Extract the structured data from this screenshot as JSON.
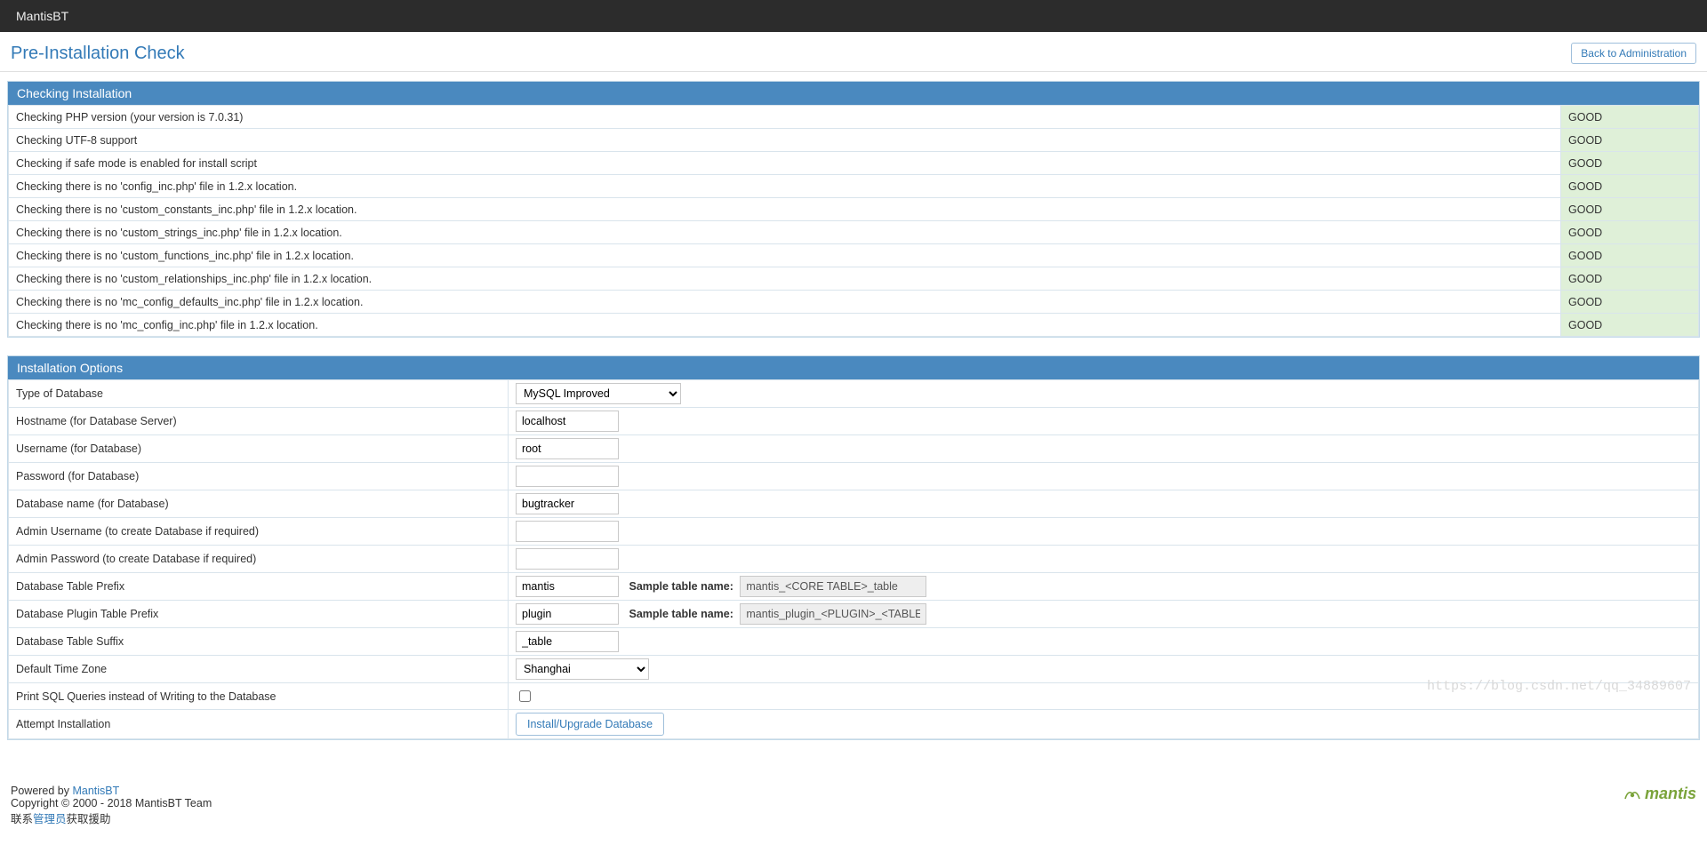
{
  "navbar": {
    "brand": "MantisBT"
  },
  "header": {
    "title": "Pre-Installation Check",
    "back_button": "Back to Administration"
  },
  "checking": {
    "heading": "Checking Installation",
    "rows": [
      {
        "label": "Checking PHP version (your version is 7.0.31)",
        "status": "GOOD"
      },
      {
        "label": "Checking UTF-8 support",
        "status": "GOOD"
      },
      {
        "label": "Checking if safe mode is enabled for install script",
        "status": "GOOD"
      },
      {
        "label": "Checking there is no 'config_inc.php' file in 1.2.x location.",
        "status": "GOOD"
      },
      {
        "label": "Checking there is no 'custom_constants_inc.php' file in 1.2.x location.",
        "status": "GOOD"
      },
      {
        "label": "Checking there is no 'custom_strings_inc.php' file in 1.2.x location.",
        "status": "GOOD"
      },
      {
        "label": "Checking there is no 'custom_functions_inc.php' file in 1.2.x location.",
        "status": "GOOD"
      },
      {
        "label": "Checking there is no 'custom_relationships_inc.php' file in 1.2.x location.",
        "status": "GOOD"
      },
      {
        "label": "Checking there is no 'mc_config_defaults_inc.php' file in 1.2.x location.",
        "status": "GOOD"
      },
      {
        "label": "Checking there is no 'mc_config_inc.php' file in 1.2.x location.",
        "status": "GOOD"
      }
    ]
  },
  "options": {
    "heading": "Installation Options",
    "db_type_label": "Type of Database",
    "db_type_value": "MySQL Improved",
    "hostname_label": "Hostname (for Database Server)",
    "hostname_value": "localhost",
    "username_label": "Username (for Database)",
    "username_value": "root",
    "password_label": "Password (for Database)",
    "password_value": "",
    "dbname_label": "Database name (for Database)",
    "dbname_value": "bugtracker",
    "admin_user_label": "Admin Username (to create Database if required)",
    "admin_user_value": "",
    "admin_pass_label": "Admin Password (to create Database if required)",
    "admin_pass_value": "",
    "table_prefix_label": "Database Table Prefix",
    "table_prefix_value": "mantis",
    "sample_label_1": "Sample table name:",
    "sample_value_1": "mantis_<CORE TABLE>_table",
    "plugin_prefix_label": "Database Plugin Table Prefix",
    "plugin_prefix_value": "plugin",
    "sample_label_2": "Sample table name:",
    "sample_value_2": "mantis_plugin_<PLUGIN>_<TABLE>_table",
    "table_suffix_label": "Database Table Suffix",
    "table_suffix_value": "_table",
    "timezone_label": "Default Time Zone",
    "timezone_value": "Shanghai",
    "print_sql_label": "Print SQL Queries instead of Writing to the Database",
    "attempt_label": "Attempt Installation",
    "install_button": "Install/Upgrade Database"
  },
  "footer": {
    "powered_prefix": "Powered by ",
    "powered_link": "MantisBT",
    "copyright": "Copyright © 2000 - 2018 MantisBT Team",
    "contact_prefix": "联系",
    "contact_link": "管理员",
    "contact_suffix": "获取援助",
    "logo_text": "mantis"
  },
  "watermark": "https://blog.csdn.net/qq_34889607"
}
